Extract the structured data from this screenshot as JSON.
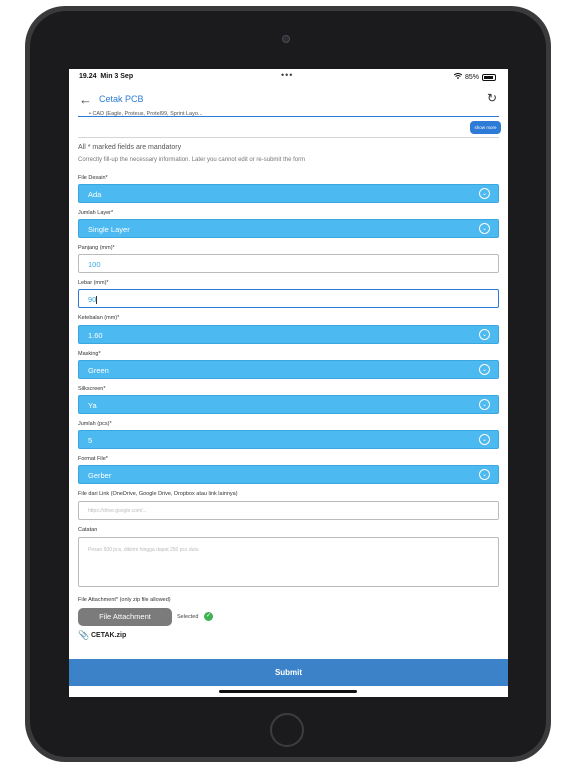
{
  "status_bar": {
    "time": "19.24",
    "date": "Min 3 Sep",
    "battery": "85%"
  },
  "app_bar": {
    "title": "Cetak PCB"
  },
  "top_note": "• CAD (Eagle, Proteus, Protel99, Sprint Layo...",
  "show_more_label": "show more",
  "mandatory_text": "All * marked fields are mandatory",
  "hint_text": "Correctly fill-up the necessary information. Later you cannot edit or re-submit the form",
  "fields": {
    "file_desain": {
      "label": "File Desain*",
      "value": "Ada"
    },
    "jumlah_layer": {
      "label": "Jumlah Layer*",
      "value": "Single Layer"
    },
    "panjang": {
      "label": "Panjang (mm)*",
      "value": "100"
    },
    "lebar": {
      "label": "Lebar (mm)*",
      "value": "90"
    },
    "ketebalan": {
      "label": "Ketebalan (mm)*",
      "value": "1.60"
    },
    "masking": {
      "label": "Masking*",
      "value": "Green"
    },
    "silkscreen": {
      "label": "Silkscreen*",
      "value": "Ya"
    },
    "jumlah": {
      "label": "Jumlah (pcs)*",
      "value": "5"
    },
    "format_file": {
      "label": "Format File*",
      "value": "Gerber"
    },
    "file_link": {
      "label": "File dari Link (OneDrive, Google Drive, Dropbox atau link lainnya)",
      "placeholder": "https://drive.google.com/..."
    },
    "catatan": {
      "label": "Catatan",
      "placeholder": "Pesan 500 pcs, dikirim hingga dapat 250 pcs dulu"
    }
  },
  "attachment": {
    "label": "File Attachment* (only zip file allowed)",
    "button_label": "File Attachment",
    "selected_text": "Selected",
    "filename": "CETAK.zip"
  },
  "submit_label": "Submit",
  "colors": {
    "accent": "#2d7bd6",
    "dropdown_bg": "#4cb9f0",
    "submit_bg": "#3c82c9",
    "success": "#3eb152"
  }
}
